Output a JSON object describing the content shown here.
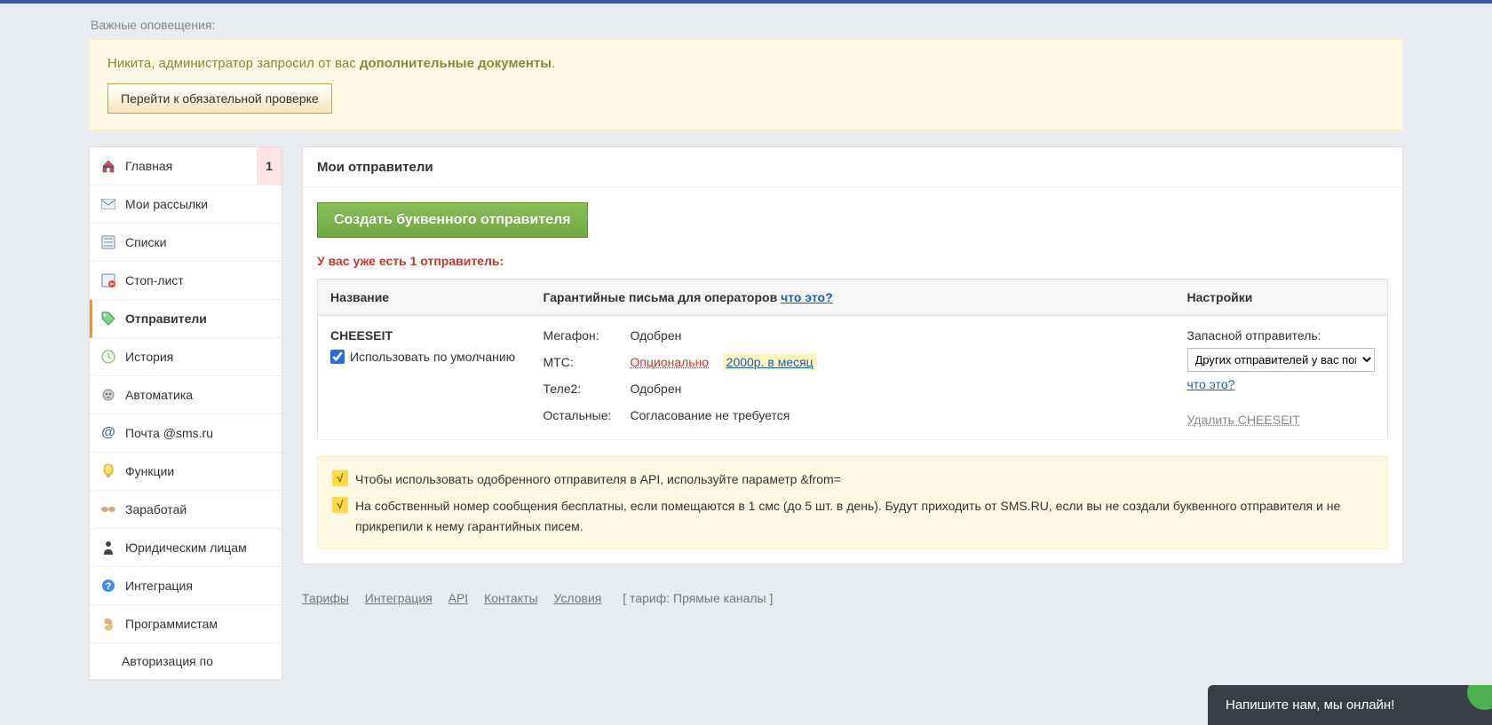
{
  "notif_label": "Важные оповещения:",
  "alert": {
    "prefix": "Никита, администратор запросил от вас ",
    "bold": "дополнительные документы",
    "suffix": ".",
    "button": "Перейти к обязательной проверке"
  },
  "sidebar": {
    "items": [
      {
        "label": "Главная",
        "badge": "1"
      },
      {
        "label": "Мои рассылки"
      },
      {
        "label": "Списки"
      },
      {
        "label": "Стоп-лист"
      },
      {
        "label": "Отправители",
        "active": true
      },
      {
        "label": "История"
      },
      {
        "label": "Автоматика"
      },
      {
        "label": "Почта @sms.ru"
      },
      {
        "label": "Функции"
      },
      {
        "label": "Заработай"
      },
      {
        "label": "Юридическим лицам"
      },
      {
        "label": "Интеграция"
      },
      {
        "label": "Программистам"
      },
      {
        "label": "Авторизация по",
        "sub": true
      }
    ]
  },
  "panel": {
    "title": "Мои отправители",
    "create_btn": "Создать буквенного отправителя",
    "red_note": "У вас уже есть 1 отправитель:"
  },
  "table": {
    "th_name": "Название",
    "th_letters_prefix": "Гарантийные письма для операторов ",
    "th_letters_link": "что это?",
    "th_settings": "Настройки",
    "sender": {
      "name": "CHEESEIT",
      "default_label": "Использовать по умолчанию",
      "ops": {
        "megafon_label": "Мегафон:",
        "megafon_val": "Одобрен",
        "mts_label": "МТС:",
        "mts_val": "Опционально",
        "mts_price": "2000р. в месяц",
        "tele2_label": "Теле2:",
        "tele2_val": "Одобрен",
        "other_label": "Остальные:",
        "other_val": "Согласование не требуется"
      },
      "settings": {
        "backup_label": "Запасной отправитель:",
        "select_value": "Других отправителей у вас пока нет",
        "what_link": "что это?",
        "delete": "Удалить CHEESEIT"
      }
    }
  },
  "info": {
    "line1": "Чтобы использовать одобренного отправителя в API, используйте параметр &from=",
    "line2": "На собственный номер сообщения бесплатны, если помещаются в 1 смс (до 5 шт. в день). Будут приходить от SMS.RU, если вы не создали буквенного отправителя и не прикрепили к нему гарантийных писем."
  },
  "footer": {
    "links": [
      "Тарифы",
      "Интеграция",
      "API",
      "Контакты",
      "Условия"
    ],
    "tariff": "[ тариф: Прямые каналы ]"
  },
  "chat": "Напишите нам, мы онлайн!"
}
